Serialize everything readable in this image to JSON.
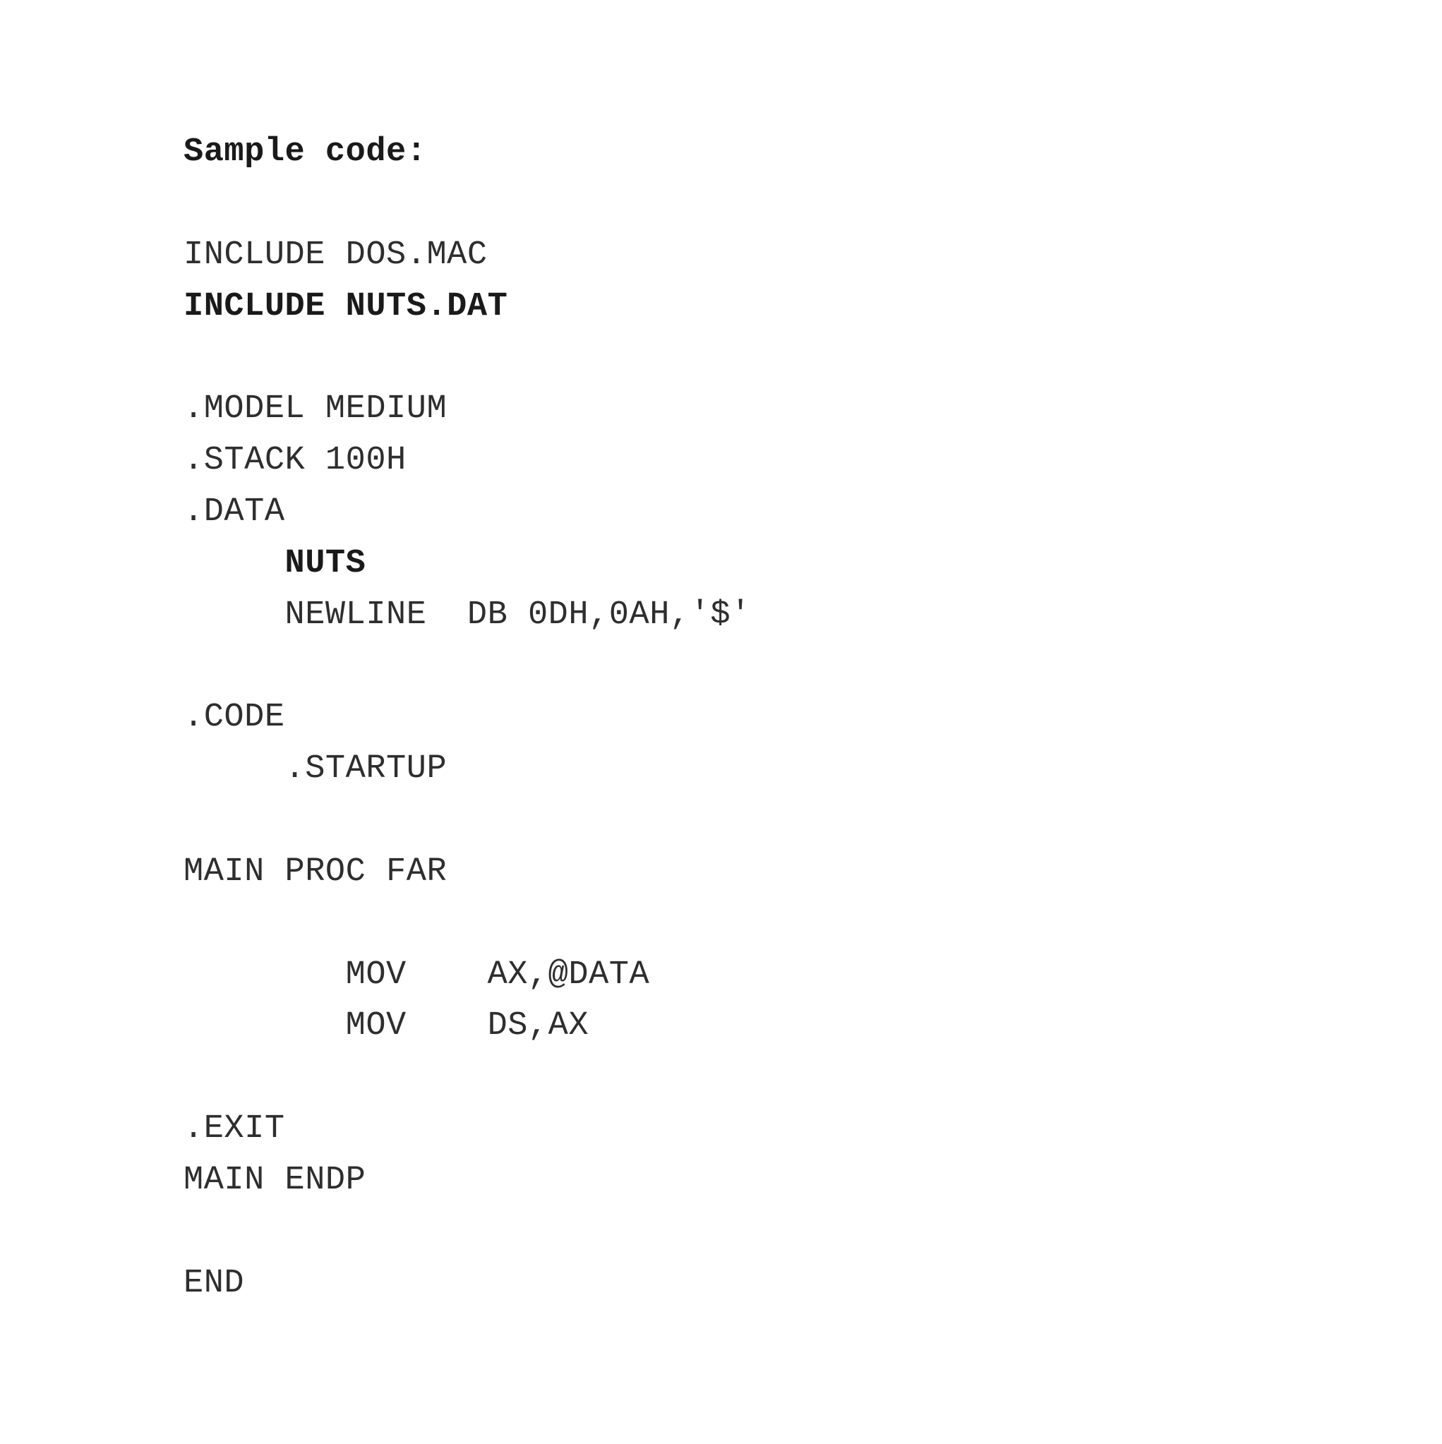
{
  "heading": "Sample code:",
  "code": {
    "l1": "INCLUDE DOS.MAC",
    "l2": "INCLUDE NUTS.DAT",
    "l3": ".MODEL MEDIUM",
    "l4": ".STACK 100H",
    "l5": ".DATA",
    "l6": "     NUTS",
    "l7": "     NEWLINE  DB 0DH,0AH,'$'",
    "l8": ".CODE",
    "l9": "     .STARTUP",
    "l10": "MAIN PROC FAR",
    "l11": "        MOV    AX,@DATA",
    "l12": "        MOV    DS,AX",
    "l13": ".EXIT",
    "l14": "MAIN ENDP",
    "l15": "END"
  }
}
